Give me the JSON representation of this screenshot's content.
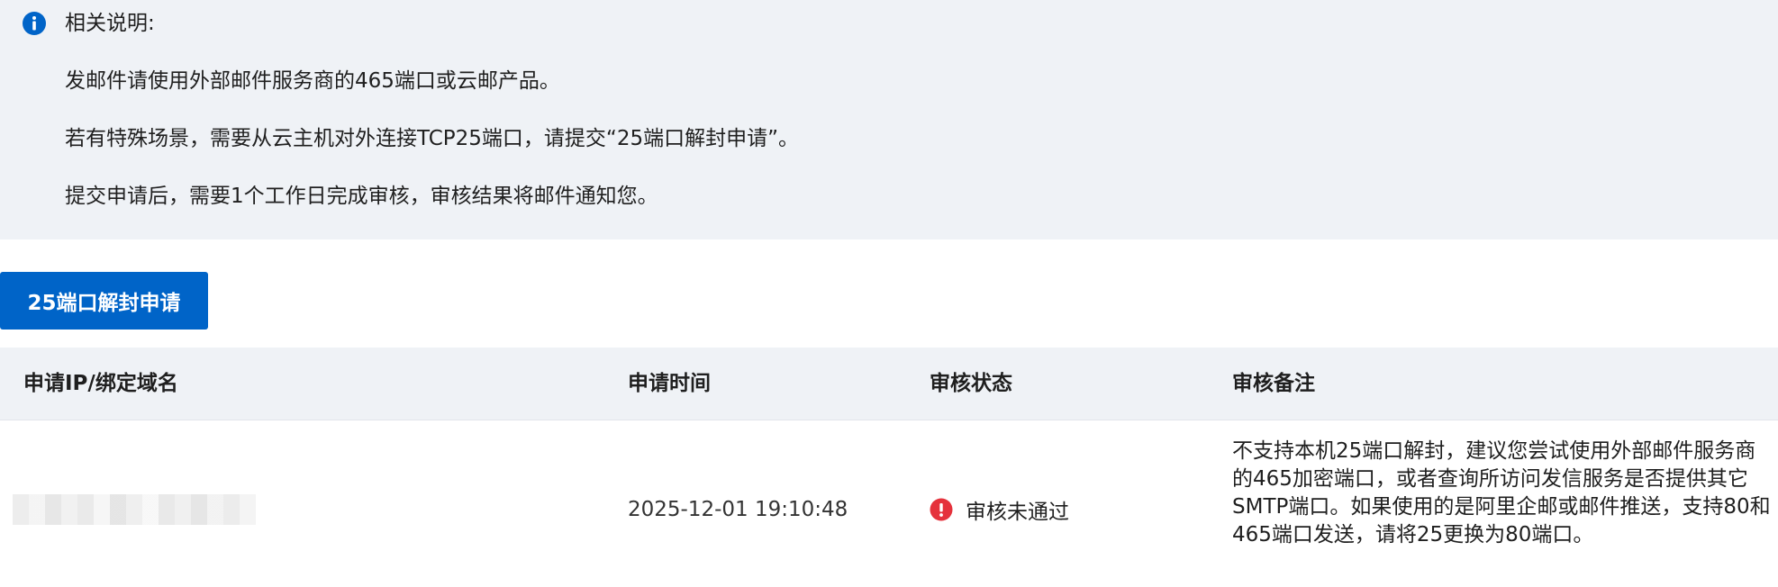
{
  "notice": {
    "title": "相关说明:",
    "lines": [
      "发邮件请使用外部邮件服务商的465端口或云邮产品。",
      "若有特殊场景，需要从云主机对外连接TCP25端口，请提交“25端口解封申请”。",
      "提交申请后，需要1个工作日完成审核，审核结果将邮件通知您。"
    ]
  },
  "actions": {
    "apply_label": "25端口解封申请"
  },
  "table": {
    "columns": [
      "申请IP/绑定域名",
      "申请时间",
      "审核状态",
      "审核备注"
    ],
    "rows": [
      {
        "ip": "",
        "time": "2025-12-01 19:10:48",
        "status": "审核未通过",
        "remark": "不支持本机25端口解封，建议您尝试使用外部邮件服务商的465加密端口，或者查询所访问发信服务是否提供其它SMTP端口。如果使用的是阿里企邮或邮件推送，支持80和465端口发送，请将25更换为80端口。"
      }
    ]
  },
  "colors": {
    "primary": "#0064c8",
    "notice_bg": "#eff2f6",
    "error": "#e5323c"
  }
}
